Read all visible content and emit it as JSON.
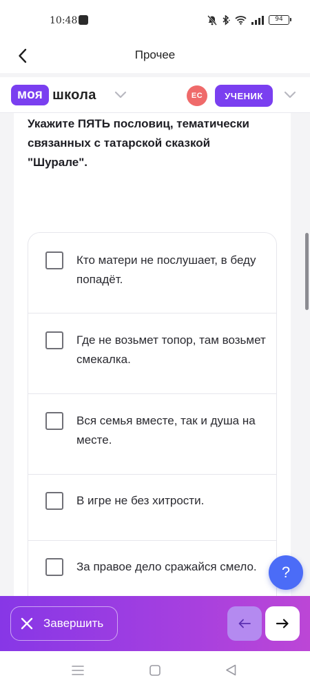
{
  "status_bar": {
    "time": "10:48",
    "battery": "94",
    "icons": [
      "mute-icon",
      "bluetooth-icon",
      "wifi-icon",
      "signal-icon",
      "battery-icon"
    ]
  },
  "nav": {
    "title": "Прочее",
    "back_icon": "chevron-left-icon"
  },
  "header": {
    "logo_part1": "моя",
    "logo_part2": "школа",
    "avatar_initials": "ЕС",
    "role": "УЧЕНИК",
    "brand_color": "#7a3ff0",
    "avatar_color": "#ef6a6a"
  },
  "question": {
    "text": "Укажите ПЯТЬ пословиц, тематически связанных с татарской сказкой \"Шурале\"."
  },
  "options": [
    {
      "label": "Кто матери не послушает, в беду попадёт.",
      "checked": false
    },
    {
      "label": "Где не возьмет топор, там возьмет смекалка.",
      "checked": false
    },
    {
      "label": "Вся семья вместе, так и душа на месте.",
      "checked": false
    },
    {
      "label": "В игре не без хитрости.",
      "checked": false
    },
    {
      "label": "За правое дело сражайся смело.",
      "checked": false
    }
  ],
  "help": {
    "label": "?"
  },
  "bottom_bar": {
    "finish_label": "Завершить",
    "prev_icon": "arrow-left-icon",
    "next_icon": "arrow-right-icon"
  }
}
